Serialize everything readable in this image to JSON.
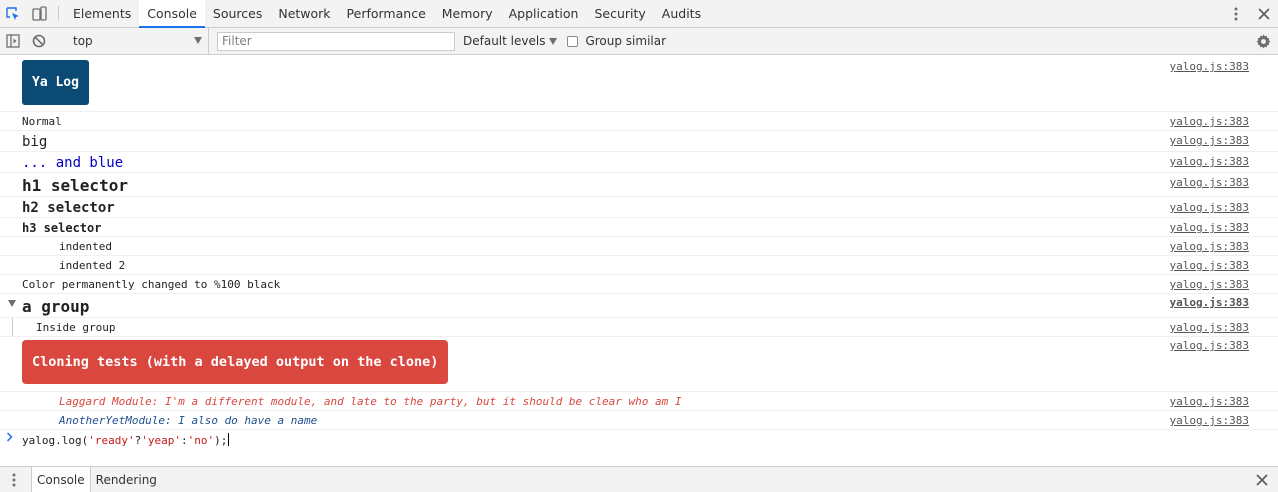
{
  "tabs": [
    "Elements",
    "Console",
    "Sources",
    "Network",
    "Performance",
    "Memory",
    "Application",
    "Security",
    "Audits"
  ],
  "active_tab": "Console",
  "toolbar": {
    "context": "top",
    "filter_placeholder": "Filter",
    "levels": "Default levels",
    "group_similar": "Group similar"
  },
  "source_link": "yalog.js:383",
  "messages": {
    "ya_log": "Ya Log",
    "normal": "Normal",
    "big": "big",
    "blue": "... and blue",
    "h1": "h1 selector",
    "h2": "h2 selector",
    "h3": "h3 selector",
    "indented": "indented",
    "indented2": "indented 2",
    "color_changed": "Color permanently changed to %100 black",
    "group": "a group",
    "inside_group": "Inside group",
    "cloning": "Cloning tests (with a delayed output on the clone)",
    "laggard": "Laggard Module: I'm a different module, and late to the party, but it should be clear who am I",
    "another": "AnotherYetModule: I also do have a name"
  },
  "prompt": {
    "p1": "yalog.log(",
    "s1": "'ready'",
    "p2": "?",
    "s2": "'yeap'",
    "p3": ":",
    "s3": "'no'",
    "p4": ");"
  },
  "drawer": {
    "tabs": [
      "Console",
      "Rendering"
    ]
  },
  "colors": {
    "ya_log_badge": "#0b4a74",
    "cloning_badge": "#d9473f",
    "blue_text": "#0000cc",
    "laggard_text": "#d9473f",
    "another_text": "#1f4f8c"
  }
}
